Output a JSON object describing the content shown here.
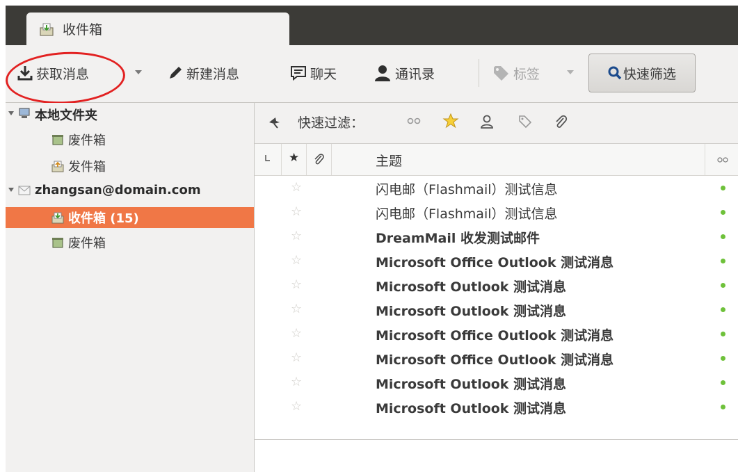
{
  "window": {
    "tab_title": "收件箱"
  },
  "toolbar": {
    "get_messages": "获取消息",
    "new_message": "新建消息",
    "chat": "聊天",
    "address_book": "通讯录",
    "tags": "标签",
    "quick_filter": "快速筛选"
  },
  "folders": {
    "local_folders": "本地文件夹",
    "local_trash": "废件箱",
    "local_outbox": "发件箱",
    "account": "zhangsan@domain.com",
    "inbox": "收件箱 (15)",
    "account_trash": "废件箱"
  },
  "quick_filter_bar": {
    "label": "快速过滤："
  },
  "columns": {
    "subject": "主题"
  },
  "messages": [
    {
      "subject": "闪电邮（Flashmail）测试信息",
      "bold": false
    },
    {
      "subject": "闪电邮（Flashmail）测试信息",
      "bold": false
    },
    {
      "subject": "DreamMail 收发测试邮件",
      "bold": true
    },
    {
      "subject": "Microsoft Office Outlook 测试消息",
      "bold": true
    },
    {
      "subject": "Microsoft Outlook 测试消息",
      "bold": true
    },
    {
      "subject": "Microsoft Outlook 测试消息",
      "bold": true
    },
    {
      "subject": "Microsoft Office Outlook 测试消息",
      "bold": true
    },
    {
      "subject": "Microsoft Office Outlook 测试消息",
      "bold": true
    },
    {
      "subject": "Microsoft Outlook 测试消息",
      "bold": true
    },
    {
      "subject": "Microsoft Outlook 测试消息",
      "bold": true
    }
  ],
  "colors": {
    "selection": "#f07746",
    "annotation": "#e22121",
    "unread_dot": "#6ec13a",
    "titlebar": "#3c3b37"
  }
}
